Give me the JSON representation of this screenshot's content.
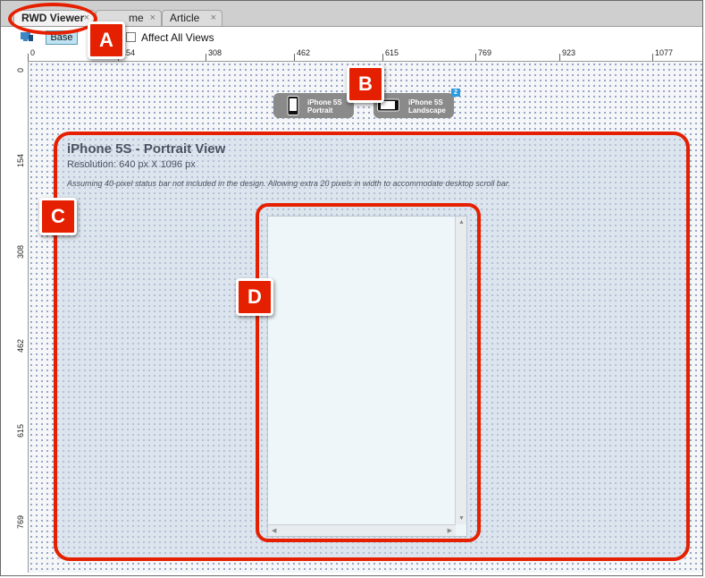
{
  "tabs": [
    {
      "label": "RWD Viewer",
      "close": "×"
    },
    {
      "label": "me",
      "close": "×"
    },
    {
      "label": "Article",
      "close": "×"
    }
  ],
  "toolbar": {
    "base_label": "Base",
    "affect_all_label": "Affect All Views"
  },
  "ruler": {
    "h_ticks": [
      "0",
      "154",
      "308",
      "462",
      "615",
      "769",
      "923",
      "1077"
    ],
    "v_ticks": [
      "0",
      "154",
      "308",
      "462",
      "615",
      "769"
    ]
  },
  "devices": [
    {
      "line1": "iPhone 5S",
      "line2": "Portrait",
      "icon": "phone-portrait-icon"
    },
    {
      "line1": "iPhone 5S",
      "line2": "Landscape",
      "icon": "phone-landscape-icon"
    }
  ],
  "badge": "2",
  "view": {
    "title": "iPhone 5S - Portrait View",
    "resolution": "Resolution: 640 px X 1096 px",
    "note": "Assuming 40-pixel status bar not included in the design. Allowing extra 20 pixels in width to accommodate desktop scroll bar."
  },
  "callouts": [
    "A",
    "B",
    "C",
    "D"
  ],
  "colors": {
    "callout": "#e52000",
    "base_active": "#bfe3f2",
    "badge": "#2d9be0"
  }
}
